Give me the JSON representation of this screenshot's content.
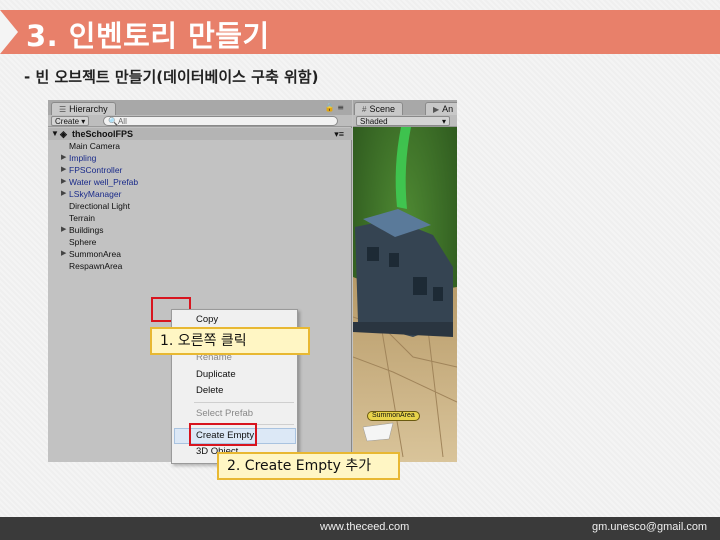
{
  "slide": {
    "title": "3. 인벤토리 만들기",
    "subtitle": "- 빈 오브젝트 만들기(데이터베이스 구축 위함)"
  },
  "hierarchy": {
    "tab_label": "Hierarchy",
    "create_label": "Create ▾",
    "search_placeholder": "All",
    "scene_name": "theSchoolFPS",
    "items": [
      {
        "label": "Main Camera",
        "expandable": false,
        "prefab": false
      },
      {
        "label": "Impling",
        "expandable": true,
        "prefab": true
      },
      {
        "label": "FPSController",
        "expandable": true,
        "prefab": true
      },
      {
        "label": "Water well_Prefab",
        "expandable": true,
        "prefab": true
      },
      {
        "label": "LSkyManager",
        "expandable": true,
        "prefab": true
      },
      {
        "label": "Directional Light",
        "expandable": false,
        "prefab": false
      },
      {
        "label": "Terrain",
        "expandable": false,
        "prefab": false
      },
      {
        "label": "Buildings",
        "expandable": true,
        "prefab": false
      },
      {
        "label": "Sphere",
        "expandable": false,
        "prefab": false
      },
      {
        "label": "SummonArea",
        "expandable": true,
        "prefab": false
      },
      {
        "label": "RespawnArea",
        "expandable": false,
        "prefab": false
      }
    ]
  },
  "scene": {
    "tab_label": "Scene",
    "tab2_label": "An",
    "shading_label": "Shaded",
    "summon_label": "SummonArea"
  },
  "context_menu": {
    "items": [
      {
        "label": "Copy",
        "disabled": false
      },
      {
        "label": "Rename",
        "disabled": true
      },
      {
        "label": "Duplicate",
        "disabled": false
      },
      {
        "label": "Delete",
        "disabled": false
      },
      {
        "label": "Select Prefab",
        "disabled": true
      },
      {
        "label": "Create Empty",
        "disabled": false,
        "highlighted": true
      },
      {
        "label": "3D Object",
        "disabled": false
      }
    ]
  },
  "callouts": {
    "step1": "1. 오른쪽 클릭",
    "step2": "2. Create Empty 추가"
  },
  "footer": {
    "website": "www.theceed.com",
    "email": "gm.unesco@gmail.com"
  },
  "colors": {
    "title_bar": "#e8806a",
    "callout_fill": "#fff6c4",
    "callout_border": "#e8b832",
    "marker_red": "#d8141e",
    "prefab_text": "#1a2b8a"
  }
}
